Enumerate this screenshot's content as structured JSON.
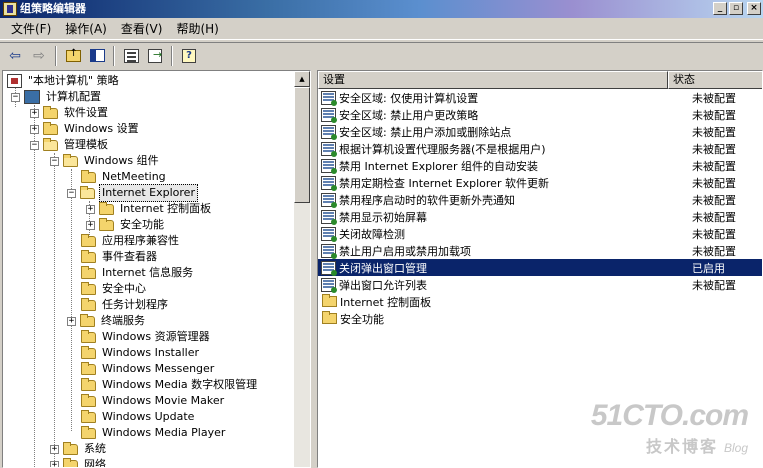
{
  "window": {
    "title": "组策略编辑器",
    "buttons": {
      "minimize": "_",
      "restore": "▫",
      "close": "×"
    }
  },
  "menu": {
    "file": "文件(F)",
    "action": "操作(A)",
    "view": "查看(V)",
    "help": "帮助(H)"
  },
  "toolbar": {
    "back": "⇦",
    "forward": "⇨"
  },
  "tree": {
    "root": "\"本地计算机\" 策略",
    "computer_config": "计算机配置",
    "software_settings": "软件设置",
    "windows_settings": "Windows 设置",
    "admin_templates": "管理模板",
    "windows_components": "Windows 组件",
    "netmeeting": "NetMeeting",
    "internet_explorer": "Internet Explorer",
    "ie_control_panel": "Internet 控制面板",
    "security_features": "安全功能",
    "app_compat": "应用程序兼容性",
    "event_viewer": "事件查看器",
    "iis": "Internet 信息服务",
    "security_center": "安全中心",
    "task_scheduler": "任务计划程序",
    "terminal_services": "终端服务",
    "explorer": "Windows 资源管理器",
    "installer": "Windows Installer",
    "messenger": "Windows Messenger",
    "media_drm": "Windows Media 数字权限管理",
    "movie_maker": "Windows Movie Maker",
    "update": "Windows Update",
    "media_player": "Windows Media Player",
    "system": "系统",
    "network": "网络",
    "expander_plus": "+",
    "expander_minus": "−"
  },
  "list": {
    "col_setting": "设置",
    "col_state": "状态",
    "rows": [
      {
        "name": "安全区域: 仅使用计算机设置",
        "state": "未被配置"
      },
      {
        "name": "安全区域: 禁止用户更改策略",
        "state": "未被配置"
      },
      {
        "name": "安全区域: 禁止用户添加或删除站点",
        "state": "未被配置"
      },
      {
        "name": "根据计算机设置代理服务器(不是根据用户)",
        "state": "未被配置"
      },
      {
        "name": "禁用 Internet Explorer 组件的自动安装",
        "state": "未被配置"
      },
      {
        "name": "禁用定期检查 Internet Explorer 软件更新",
        "state": "未被配置"
      },
      {
        "name": "禁用程序启动时的软件更新外壳通知",
        "state": "未被配置"
      },
      {
        "name": "禁用显示初始屏幕",
        "state": "未被配置"
      },
      {
        "name": "关闭故障检测",
        "state": "未被配置"
      },
      {
        "name": "禁止用户启用或禁用加载项",
        "state": "未被配置"
      },
      {
        "name": "关闭弹出窗口管理",
        "state": "已启用"
      },
      {
        "name": "弹出窗口允许列表",
        "state": "未被配置"
      }
    ],
    "folders": [
      {
        "name": "Internet 控制面板"
      },
      {
        "name": "安全功能"
      }
    ]
  },
  "watermark": {
    "main": "51CTO.com",
    "sub": "技术博客",
    "blog": "Blog"
  }
}
